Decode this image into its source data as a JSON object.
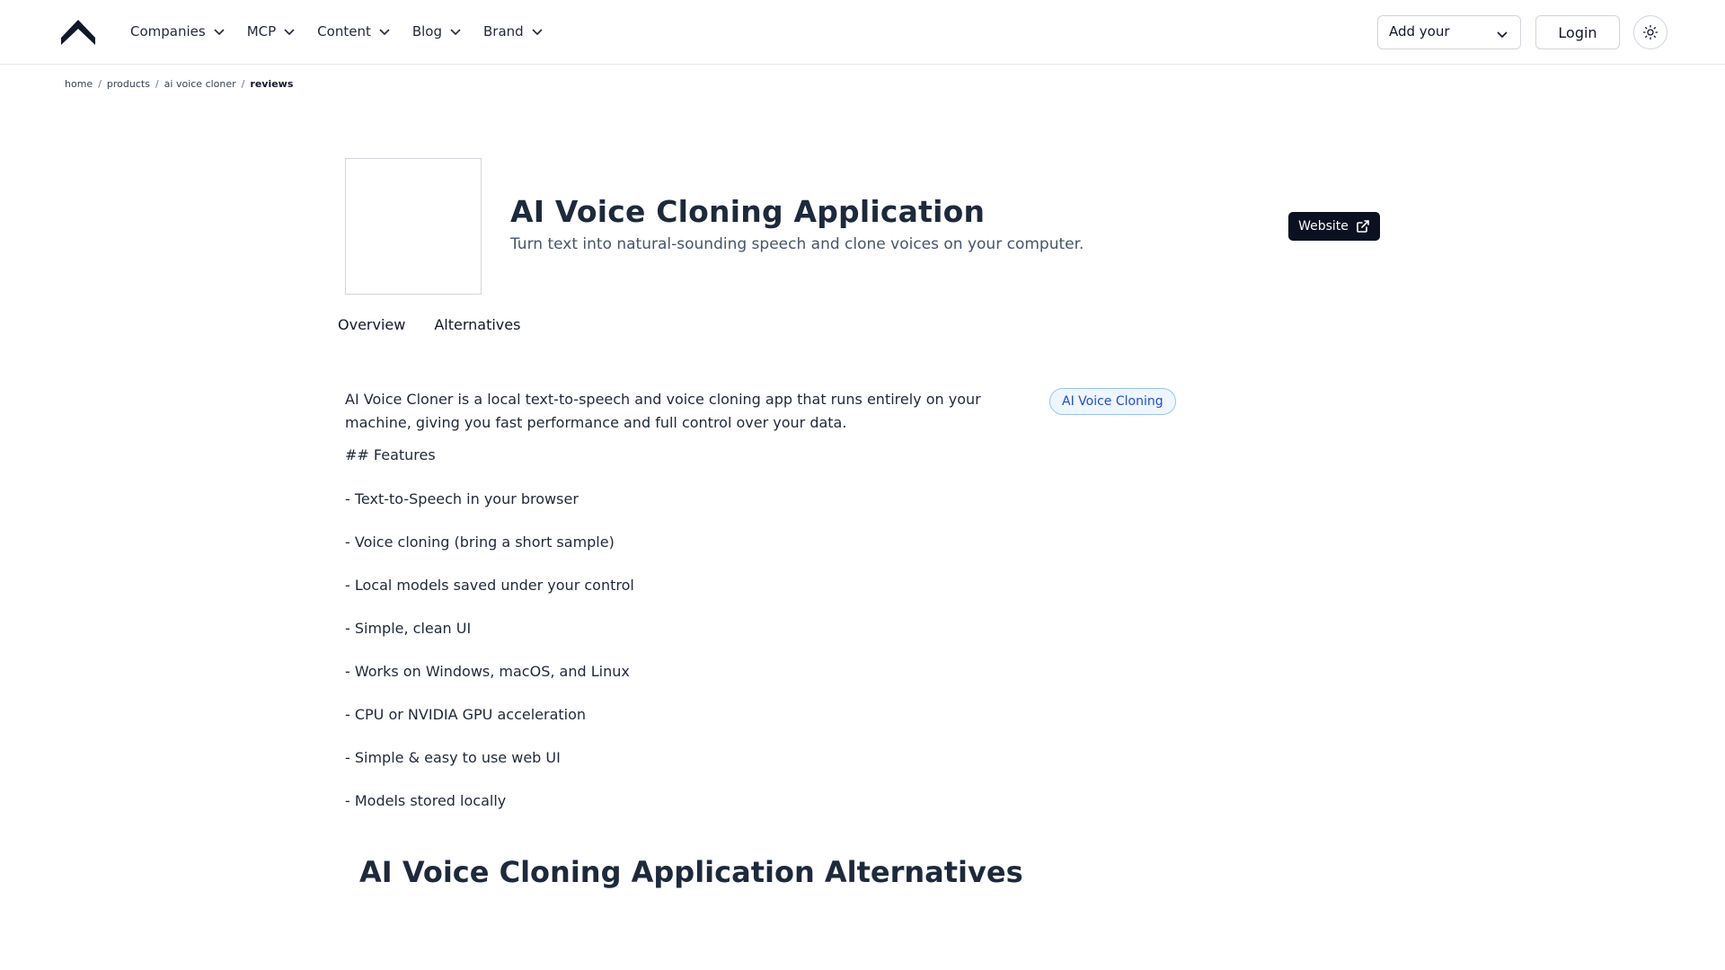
{
  "header": {
    "nav": [
      {
        "label": "Companies"
      },
      {
        "label": "MCP"
      },
      {
        "label": "Content"
      },
      {
        "label": "Blog"
      },
      {
        "label": "Brand"
      }
    ],
    "add_select": {
      "value": "Add your"
    },
    "login_label": "Login",
    "theme_icon": "sun-icon"
  },
  "breadcrumb": {
    "items": [
      "home",
      "products",
      "ai voice cloner"
    ],
    "current": "reviews"
  },
  "product": {
    "title": "AI Voice Cloning Application",
    "tagline": "Turn text into natural-sounding speech and clone voices on your computer.",
    "website_label": "Website"
  },
  "tabs": [
    {
      "label": "Overview"
    },
    {
      "label": "Alternatives"
    }
  ],
  "content": {
    "description": "AI Voice Cloner is a local text-to-speech and voice cloning app that runs entirely on your machine, giving you fast performance and full control over your data.",
    "category": "AI Voice Cloning",
    "features_heading": "## Features",
    "features": [
      "- Text-to-Speech in your browser",
      "- Voice cloning (bring a short sample)",
      "- Local models saved under your control",
      "- Simple, clean UI",
      "- Works on Windows, macOS, and Linux",
      "- CPU or NVIDIA GPU acceleration",
      "- Simple & easy to use web UI",
      "- Models stored locally"
    ],
    "alternatives_heading": "AI Voice Cloning Application Alternatives"
  },
  "colors": {
    "primary_button": "#0b1120",
    "tag_bg": "#eff6ff",
    "tag_text": "#1d4ed8",
    "title_text": "#1e293b"
  }
}
